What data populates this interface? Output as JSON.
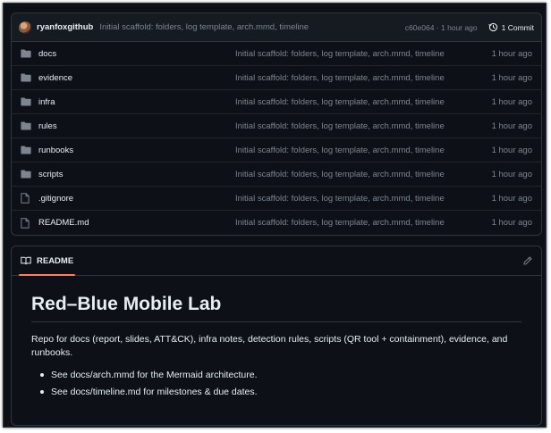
{
  "commit": {
    "author": "ryanfoxgithub",
    "message": "Initial scaffold: folders, log template, arch.mmd, timeline",
    "meta": "c60e064 · 1 hour ago",
    "count_label": "1 Commit"
  },
  "files": [
    {
      "name": "docs",
      "type": "folder",
      "message": "Initial scaffold: folders, log template, arch.mmd, timeline",
      "age": "1 hour ago"
    },
    {
      "name": "evidence",
      "type": "folder",
      "message": "Initial scaffold: folders, log template, arch.mmd, timeline",
      "age": "1 hour ago"
    },
    {
      "name": "infra",
      "type": "folder",
      "message": "Initial scaffold: folders, log template, arch.mmd, timeline",
      "age": "1 hour ago"
    },
    {
      "name": "rules",
      "type": "folder",
      "message": "Initial scaffold: folders, log template, arch.mmd, timeline",
      "age": "1 hour ago"
    },
    {
      "name": "runbooks",
      "type": "folder",
      "message": "Initial scaffold: folders, log template, arch.mmd, timeline",
      "age": "1 hour ago"
    },
    {
      "name": "scripts",
      "type": "folder",
      "message": "Initial scaffold: folders, log template, arch.mmd, timeline",
      "age": "1 hour ago"
    },
    {
      "name": ".gitignore",
      "type": "file",
      "message": "Initial scaffold: folders, log template, arch.mmd, timeline",
      "age": "1 hour ago"
    },
    {
      "name": "README.md",
      "type": "file",
      "message": "Initial scaffold: folders, log template, arch.mmd, timeline",
      "age": "1 hour ago"
    }
  ],
  "readme": {
    "tab_label": "README",
    "title": "Red–Blue Mobile Lab",
    "paragraph": "Repo for docs (report, slides, ATT&CK), infra notes, detection rules, scripts (QR tool + containment), evidence, and runbooks.",
    "bullets": [
      "See docs/arch.mmd for the Mermaid architecture.",
      "See docs/timeline.md for milestones & due dates."
    ]
  },
  "colors": {
    "background": "#0d1117",
    "border": "#30363d",
    "muted_text": "#7d8590",
    "accent_underline": "#f78166",
    "folder_icon": "#7d8590"
  },
  "icons": {
    "folder": "folder-icon",
    "file": "file-icon",
    "history": "history-icon",
    "book": "book-icon",
    "pencil": "pencil-icon"
  }
}
